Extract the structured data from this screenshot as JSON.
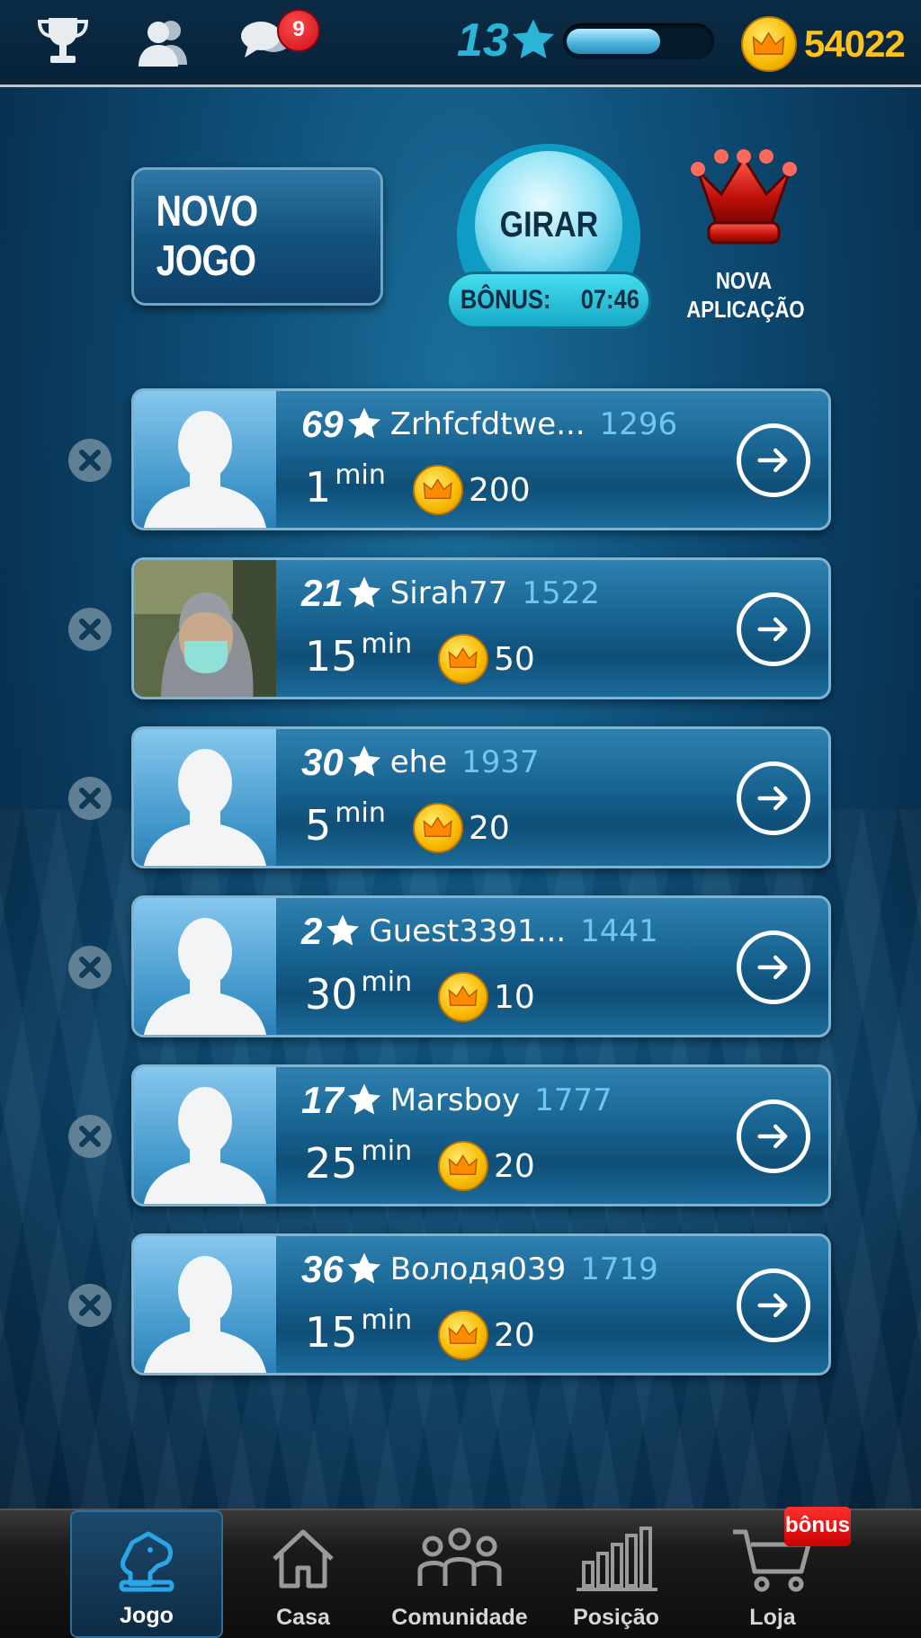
{
  "top_bar": {
    "icons": [
      "trophy-icon",
      "friends-icon",
      "chat-icon"
    ],
    "unread_messages": "9",
    "level": "13",
    "xp_progress": 0.65,
    "coins": "54022"
  },
  "header": {
    "new_game_label": "NOVO JOGO",
    "spin_label": "GIRAR",
    "bonus_label": "BÔNUS:",
    "bonus_timer": "07:46",
    "new_app_line1": "NOVA",
    "new_app_line2": "APLICAÇÃO"
  },
  "games": [
    {
      "level": "69",
      "name": "Zrhfcfdtwe...",
      "rating": "1296",
      "time": "1",
      "unit": "min",
      "bet": "200",
      "photo": false
    },
    {
      "level": "21",
      "name": "Sirah77",
      "rating": "1522",
      "time": "15",
      "unit": "min",
      "bet": "50",
      "photo": true
    },
    {
      "level": "30",
      "name": "ehe",
      "rating": "1937",
      "time": "5",
      "unit": "min",
      "bet": "20",
      "photo": false
    },
    {
      "level": "2",
      "name": "Guest3391...",
      "rating": "1441",
      "time": "30",
      "unit": "min",
      "bet": "10",
      "photo": false
    },
    {
      "level": "17",
      "name": "Marsboy",
      "rating": "1777",
      "time": "25",
      "unit": "min",
      "bet": "20",
      "photo": false
    },
    {
      "level": "36",
      "name": "Володя039",
      "rating": "1719",
      "time": "15",
      "unit": "min",
      "bet": "20",
      "photo": false
    }
  ],
  "nav": {
    "items": [
      {
        "label": "Jogo",
        "icon": "chess-knight-icon",
        "active": true
      },
      {
        "label": "Casa",
        "icon": "house-icon",
        "active": false
      },
      {
        "label": "Comunidade",
        "icon": "community-icon",
        "active": false
      },
      {
        "label": "Posição",
        "icon": "bar-chart-icon",
        "active": false
      },
      {
        "label": "Loja",
        "icon": "cart-icon",
        "active": false
      }
    ],
    "shop_badge": "bônus"
  },
  "colors": {
    "accent": "#2ab4d6",
    "coin": "#ffc21a",
    "rating": "#6fc6f0",
    "badge": "#c80f18"
  }
}
